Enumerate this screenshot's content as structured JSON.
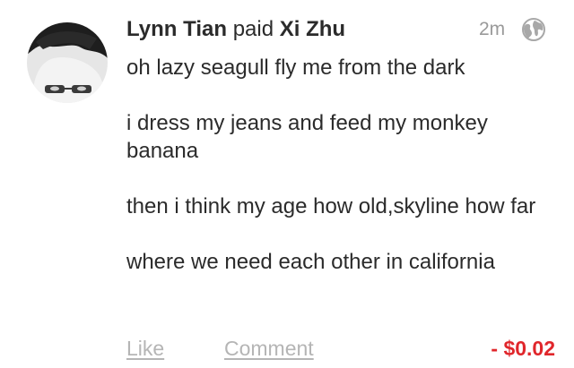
{
  "story": {
    "actor": "Lynn Tian",
    "verb": "paid",
    "target": "Xi Zhu",
    "time": "2m",
    "privacy_icon": "globe-icon",
    "message": [
      "oh lazy seagull fly me from the dark",
      "i dress my jeans and feed my monkey banana",
      "then i think my age how old,skyline how far",
      "where we need each other in california"
    ],
    "actions": {
      "like": "Like",
      "comment": "Comment"
    },
    "amount": "- $0.02"
  },
  "colors": {
    "text": "#2b2b2b",
    "muted": "#9a9a9a",
    "action": "#b5b5b5",
    "amount": "#e0262b"
  }
}
